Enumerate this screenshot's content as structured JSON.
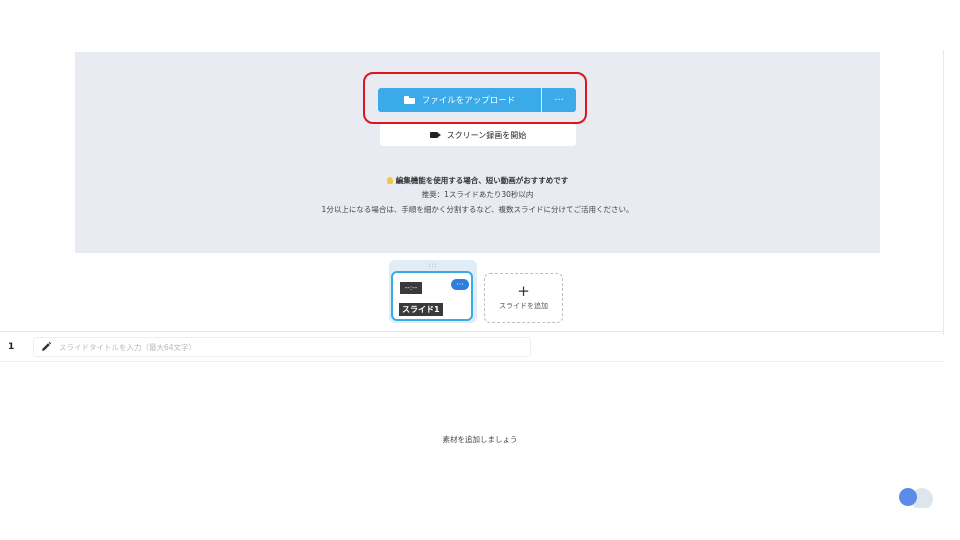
{
  "upload": {
    "upload_label": "ファイルをアップロード",
    "more_label": "···",
    "record_label": "スクリーン録画を開始"
  },
  "notice": {
    "headline": "編集機能を使用する場合、短い動画がおすすめです",
    "recommendation": "推奨：1スライドあたり30秒以内",
    "advice": "1分以上になる場合は、手順を細かく分割するなど、複数スライドに分けてご活用ください。"
  },
  "slides": {
    "items": [
      {
        "time": "--:--",
        "name": "スライド1",
        "menu": "···",
        "handle": ":::"
      }
    ],
    "add_plus": "+",
    "add_label": "スライドを追加"
  },
  "title_row": {
    "number": "1",
    "placeholder": "スライドタイトルを入力（最大64文字）",
    "value": ""
  },
  "empty_state": {
    "message": "素材を追加しましょう"
  },
  "colors": {
    "accent": "#3aaae8",
    "highlight": "#e0141b",
    "panel_bg": "#e8ecf2"
  }
}
